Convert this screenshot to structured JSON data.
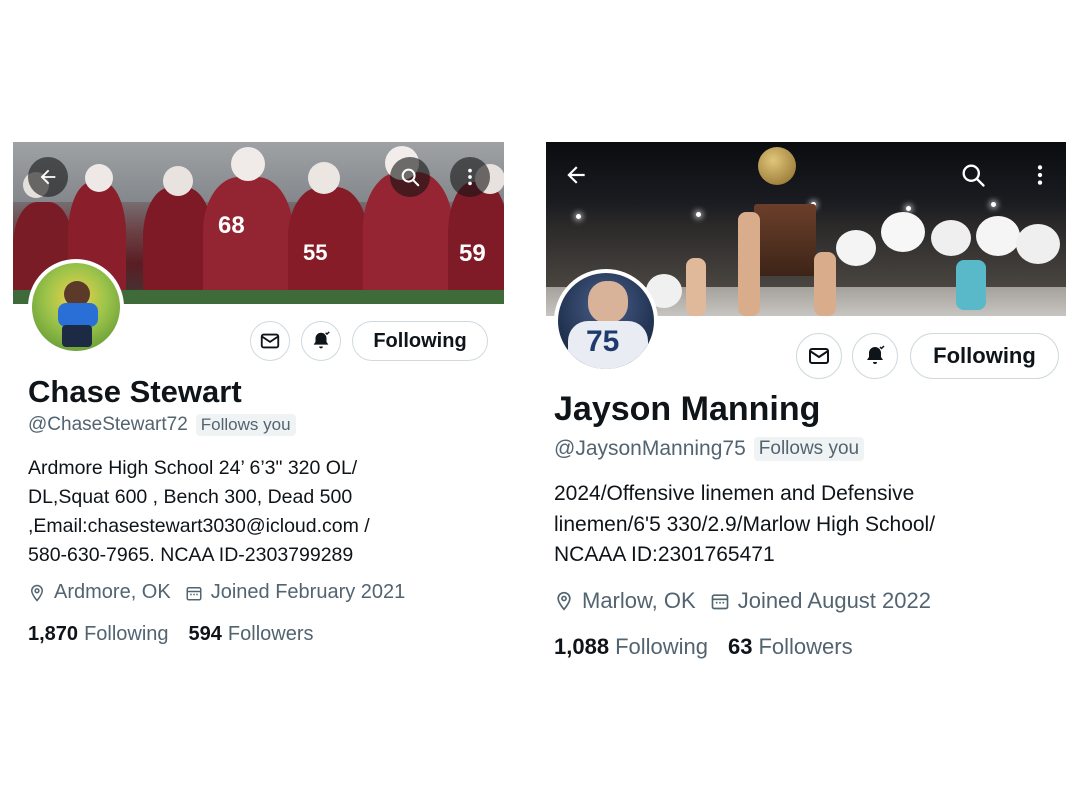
{
  "profiles": [
    {
      "name": "Chase Stewart",
      "handle": "@ChaseStewart72",
      "follows_you": "Follows you",
      "bio": "Ardmore High School 24’ 6’3\" 320  OL/\nDL,Squat 600 , Bench 300, Dead 500\n,Email:chasestewart3030@icloud.com /\n580-630-7965. NCAA ID-2303799289",
      "location": "Ardmore, OK",
      "joined": "Joined February 2021",
      "following_count": "1,870",
      "following_label": "Following",
      "followers_count": "594",
      "followers_label": "Followers",
      "follow_button": "Following",
      "banner_jerseys": [
        "68",
        "55",
        "59"
      ],
      "icons": [
        "back-arrow-icon",
        "search-icon",
        "more-icon",
        "mail-icon",
        "bell-icon",
        "location-pin-icon",
        "calendar-icon"
      ]
    },
    {
      "name": "Jayson Manning",
      "handle": "@JaysonManning75",
      "follows_you": "Follows you",
      "bio": "2024/Offensive linemen and Defensive\nlinemen/6'5 330/2.9/Marlow High School/\nNCAAA ID:2301765471",
      "location": "Marlow, OK",
      "joined": "Joined August 2022",
      "following_count": "1,088",
      "following_label": "Following",
      "followers_count": "63",
      "followers_label": "Followers",
      "follow_button": "Following",
      "avatar_jersey": "75",
      "icons": [
        "back-arrow-icon",
        "search-icon",
        "more-icon",
        "mail-icon",
        "bell-icon",
        "location-pin-icon",
        "calendar-icon"
      ]
    }
  ],
  "colors": {
    "text_primary": "#0f1419",
    "text_secondary": "#536471",
    "border": "#cfd9de",
    "maroon": "#8b1e2b"
  }
}
